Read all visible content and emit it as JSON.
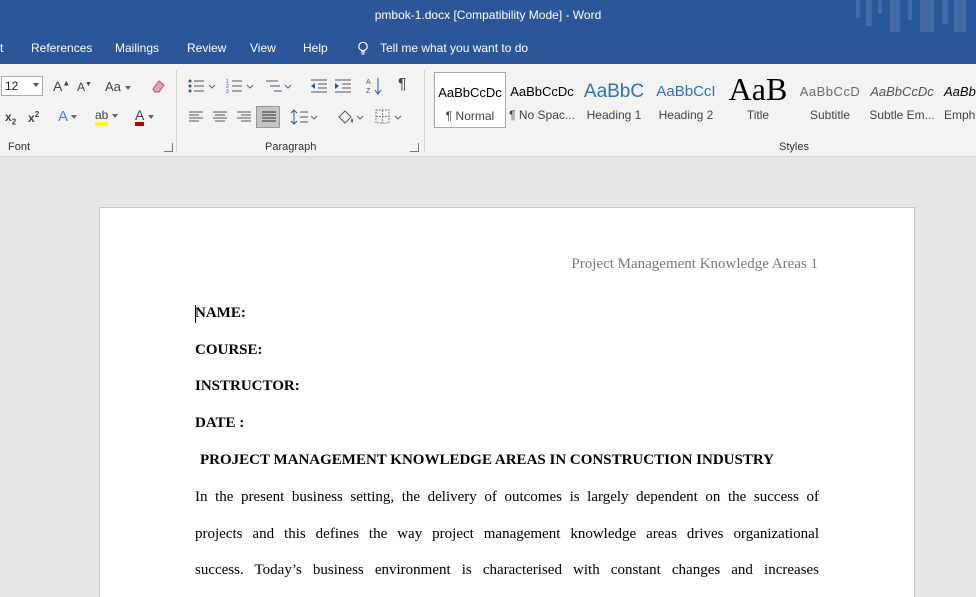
{
  "window": {
    "title": "pmbok-1.docx [Compatibility Mode]  -  Word"
  },
  "menu": {
    "tabs": [
      "t",
      "References",
      "Mailings",
      "Review",
      "View",
      "Help"
    ],
    "tellme": "Tell me what you want to do"
  },
  "ribbon": {
    "font_size": "12",
    "grow_font": "A",
    "shrink_font": "A",
    "change_case": "Aa",
    "subscript": "x",
    "superscript": "x",
    "text_effects": "A",
    "highlight": "ab",
    "font_color": "A",
    "pilcrow": "¶",
    "groups": {
      "font": "Font",
      "paragraph": "Paragraph",
      "styles": "Styles"
    },
    "styles": [
      {
        "preview": "AaBbCcDc",
        "name": "¶ Normal"
      },
      {
        "preview": "AaBbCcDc",
        "name": "¶ No Spac..."
      },
      {
        "preview": "AaBbC",
        "name": "Heading 1"
      },
      {
        "preview": "AaBbCcI",
        "name": "Heading 2"
      },
      {
        "preview": "AaB",
        "name": "Title"
      },
      {
        "preview": "AaBbCcD",
        "name": "Subtitle"
      },
      {
        "preview": "AaBbCcDc",
        "name": "Subtle Em..."
      },
      {
        "preview": "AaBb",
        "name": "Emph"
      }
    ]
  },
  "colors": {
    "accent": "#2b579a",
    "highlight_bar": "#ffff00",
    "font_color_bar": "#c00000"
  },
  "document": {
    "header": "Project Management Knowledge Areas 1",
    "fields": [
      "NAME:",
      "COURSE:",
      "INSTRUCTOR:",
      "DATE :"
    ],
    "title": "PROJECT MANAGEMENT KNOWLEDGE AREAS IN CONSTRUCTION INDUSTRY",
    "paragraph_lines": [
      "In the present business setting, the delivery of outcomes is largely dependent on the success of",
      "projects and this defines the way project management knowledge areas drives organizational",
      "success.  Today’s business environment is characterised with constant changes and increases"
    ]
  }
}
